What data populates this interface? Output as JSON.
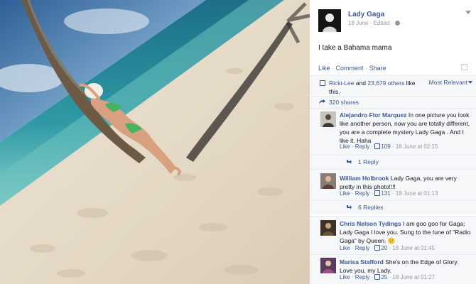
{
  "post": {
    "author": "Lady Gaga",
    "date": "18 June",
    "edited": "Edited",
    "dot": "·",
    "status": "I take a Bahama mama",
    "actions": {
      "like": "Like",
      "comment": "Comment",
      "share": "Share",
      "sep": "·"
    },
    "likes": {
      "first_name": "Ricki-Lee",
      "and": "and",
      "others": "23,679 others",
      "suffix": "like this."
    },
    "sort": "Most Relevant",
    "shares": "320 shares"
  },
  "comments": [
    {
      "name": "Alejandro Flor Marquez",
      "text": "In one picture you look like another person, now you are totally different, you are a complete mystery Lady Gaga . And I like it. Haha",
      "like": "Like",
      "reply": "Reply",
      "count": "109",
      "time": "18 June at 02:15",
      "replies": "1 Reply"
    },
    {
      "name": "William Holbrook",
      "text": "Lady Gaga, you are very pretty in this photo!!!!",
      "like": "Like",
      "reply": "Reply",
      "count": "131",
      "time": "18 June at 01:13",
      "replies": "6 Replies"
    },
    {
      "name": "Chris Nelson Tydings",
      "text": "I am goo goo for Gaga; Lady Gaga I love you. Sung to the tune of \"Radio Gaga\" by Queen. 🙂",
      "like": "Like",
      "reply": "Reply",
      "count": "20",
      "time": "18 June at 01:45"
    },
    {
      "name": "Marisa Stafford",
      "text": "She's on the Edge of Glory. Love you, my Lady.",
      "like": "Like",
      "reply": "Reply",
      "count": "25",
      "time": "18 June at 01:27"
    }
  ],
  "icons": {
    "globe": "globe-icon",
    "caret": "chevron-down-icon",
    "thumb": "thumbs-up-icon",
    "share": "share-icon",
    "reply": "reply-arrow-icon"
  },
  "colors": {
    "link": "#3b5998",
    "meta": "#9197a3",
    "panel_bg": "#f6f7f9"
  }
}
